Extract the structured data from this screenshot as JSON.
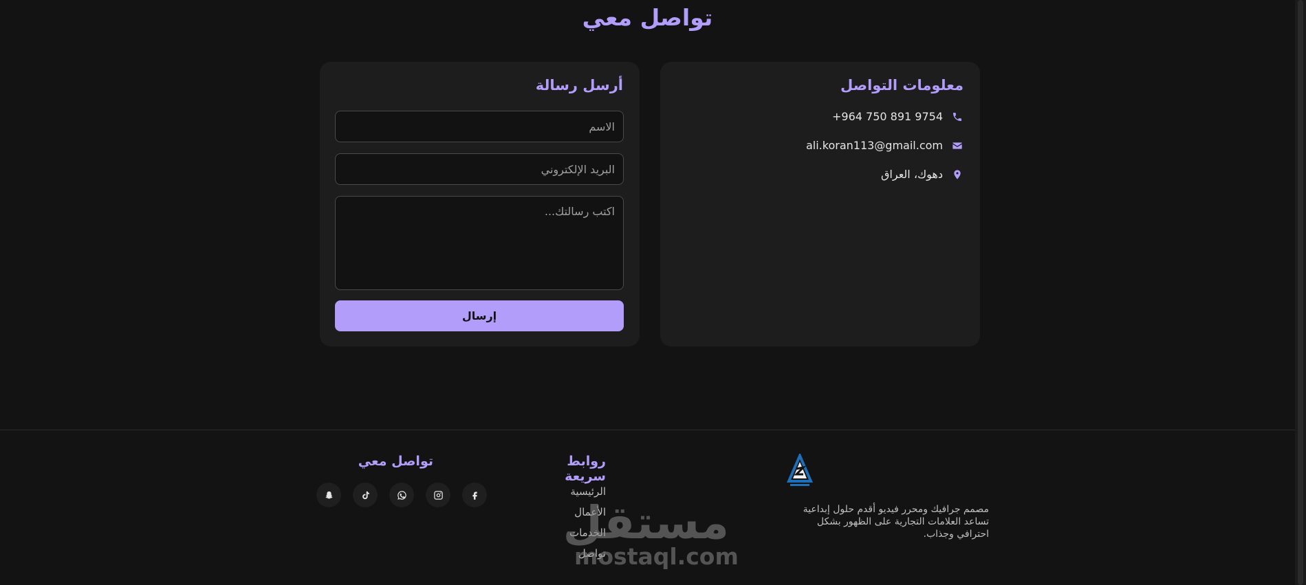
{
  "page": {
    "title": "تواصل معي",
    "accent": "#b39dfb",
    "background": "#131313"
  },
  "contact_info": {
    "heading": "معلومات التواصل",
    "phone": "+964 750 891 9754",
    "email": "ali.koran113@gmail.com",
    "location": "دهوك، العراق",
    "icons": [
      "phone-icon",
      "envelope-icon",
      "map-pin-icon"
    ]
  },
  "message_form": {
    "heading": "أرسل رسالة",
    "name_placeholder": "الاسم",
    "email_placeholder": "البريد الإلكتروني",
    "message_placeholder": "اكتب رسالتك...",
    "submit_label": "إرسال"
  },
  "footer": {
    "brand_description": "مصمم جرافيك ومحرر فيديو أقدم حلول إبداعية تساعد العلامات التجارية على الظهور بشكل احترافي وجذاب.",
    "quick_links": {
      "heading": "روابط سريعة",
      "items": [
        "الرئيسية",
        "الأعمال",
        "الخدمات",
        "تواصل"
      ]
    },
    "social": {
      "heading": "تواصل معي",
      "icons": [
        "facebook-icon",
        "instagram-icon",
        "whatsapp-icon",
        "tiktok-icon",
        "snapchat-icon"
      ]
    }
  },
  "watermark": {
    "arabic": "مستقل",
    "latin": "mostaql.com"
  }
}
